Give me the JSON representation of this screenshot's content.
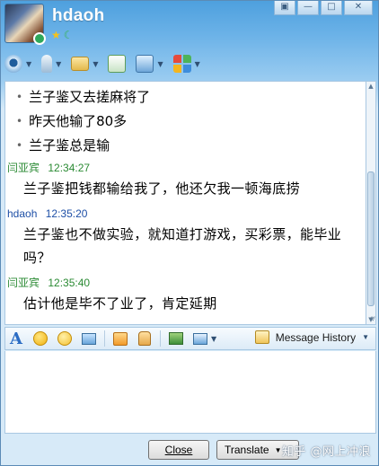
{
  "header": {
    "contact_name": "hdaoh",
    "status_icons": [
      "star-icon",
      "moon-icon"
    ],
    "window_controls": [
      "menu-icon",
      "minimize-icon",
      "maximize-icon",
      "close-icon"
    ]
  },
  "toolbar": {
    "items": [
      "video-icon",
      "microphone-icon",
      "file-transfer-icon",
      "chat-plus-icon",
      "screen-share-icon",
      "apps-icon"
    ]
  },
  "chat": {
    "bullets": [
      "兰子鉴又去搓麻将了",
      "昨天他输了80多",
      "兰子鉴总是输"
    ],
    "messages": [
      {
        "sender": "闫亚宾",
        "time": "12:34:27",
        "text": "兰子鉴把钱都输给我了，他还欠我一顿海底捞"
      },
      {
        "sender": "hdaoh",
        "time": "12:35:20",
        "text": "兰子鉴也不做实验，就知道打游戏，买彩票，能毕业吗？"
      },
      {
        "sender": "闫亚宾",
        "time": "12:35:40",
        "text": "估计他是毕不了业了，肯定延期"
      }
    ]
  },
  "format_bar": {
    "font_label": "A",
    "history_label": "Message History"
  },
  "buttons": {
    "close": "Close",
    "translate": "Translate"
  },
  "watermark": "知乎 @网上冲浪",
  "colors": {
    "sender_other": "#2a8a33",
    "sender_self": "#1e4fa6",
    "accent": "#4ea0de"
  }
}
